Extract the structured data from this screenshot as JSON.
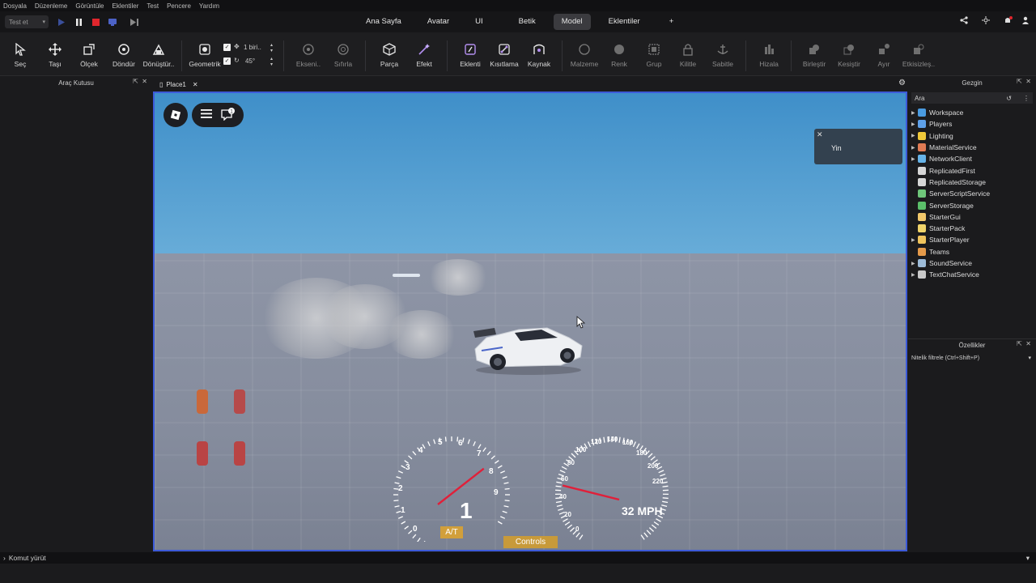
{
  "menu": [
    "Dosyala",
    "Düzenleme",
    "Görüntüle",
    "Eklentiler",
    "Test",
    "Pencere",
    "Yardım"
  ],
  "test_selector": "Test et",
  "tabs": [
    {
      "label": "Ana Sayfa",
      "active": false
    },
    {
      "label": "Avatar",
      "active": false
    },
    {
      "label": "UI",
      "active": false
    },
    {
      "label": "Betik",
      "active": false
    },
    {
      "label": "Model",
      "active": true
    },
    {
      "label": "Eklentiler",
      "active": false
    },
    {
      "label": "+",
      "active": false
    }
  ],
  "toolbar": {
    "select": "Seç",
    "move": "Taşı",
    "scale": "Ölçek",
    "rotate": "Döndür",
    "transform": "Dönüştür..",
    "geometric": "Geometrik",
    "move_step": "1 biri..",
    "rotate_step": "45°",
    "pivot": "Ekseni..",
    "reset": "Sıfırla",
    "part": "Parça",
    "effect": "Efekt",
    "plugin": "Eklenti",
    "constraints": "Kısıtlama",
    "source": "Kaynak",
    "material": "Malzeme",
    "color": "Renk",
    "group": "Grup",
    "lock": "Kilitle",
    "anchor": "Sabitle",
    "align": "Hizala",
    "union": "Birleştir",
    "intersect": "Kesiştir",
    "separate": "Ayır",
    "disable": "Etkisizleş.."
  },
  "left_panel": {
    "title": "Araç Kutusu"
  },
  "document_tab": "Place1",
  "viewport": {
    "notification": "Yin",
    "gear": "1",
    "transmission": "A/T",
    "speed": "32 MPH",
    "controls_label": "Controls",
    "rpm_ticks": [
      "0",
      "1",
      "2",
      "3",
      "4",
      "5",
      "6",
      "7",
      "8",
      "9"
    ],
    "speed_ticks": [
      "0",
      "20",
      "40",
      "60",
      "80",
      "100",
      "120",
      "140",
      "160",
      "180",
      "200",
      "220"
    ]
  },
  "explorer": {
    "title": "Gezgin",
    "search_placeholder": "Ara",
    "items": [
      {
        "label": "Workspace",
        "expandable": true,
        "icon_color": "#4a9be0"
      },
      {
        "label": "Players",
        "expandable": true,
        "icon_color": "#5ea0e8"
      },
      {
        "label": "Lighting",
        "expandable": true,
        "icon_color": "#f0c93a"
      },
      {
        "label": "MaterialService",
        "expandable": true,
        "icon_color": "#e07b54"
      },
      {
        "label": "NetworkClient",
        "expandable": true,
        "icon_color": "#66b3e8"
      },
      {
        "label": "ReplicatedFirst",
        "expandable": false,
        "icon_color": "#d6d6d6"
      },
      {
        "label": "ReplicatedStorage",
        "expandable": false,
        "icon_color": "#d6d6d6"
      },
      {
        "label": "ServerScriptService",
        "expandable": false,
        "icon_color": "#6ec67a"
      },
      {
        "label": "ServerStorage",
        "expandable": false,
        "icon_color": "#5bbf6a"
      },
      {
        "label": "StarterGui",
        "expandable": false,
        "icon_color": "#f2c86b"
      },
      {
        "label": "StarterPack",
        "expandable": false,
        "icon_color": "#f0d46a"
      },
      {
        "label": "StarterPlayer",
        "expandable": true,
        "icon_color": "#f0c45c"
      },
      {
        "label": "Teams",
        "expandable": false,
        "icon_color": "#e49a4a"
      },
      {
        "label": "SoundService",
        "expandable": true,
        "icon_color": "#9dbbd8"
      },
      {
        "label": "TextChatService",
        "expandable": true,
        "icon_color": "#c9c9c9"
      }
    ]
  },
  "properties": {
    "title": "Özellikler",
    "filter_placeholder": "Nitelik filtrele (Ctrl+Shift+P)"
  },
  "command_bar": {
    "placeholder": "Komut yürüt"
  },
  "colors": {
    "viewport_border": "#3c5ad8",
    "needle": "#e0203a",
    "active_tab": "#3b3b3f"
  }
}
